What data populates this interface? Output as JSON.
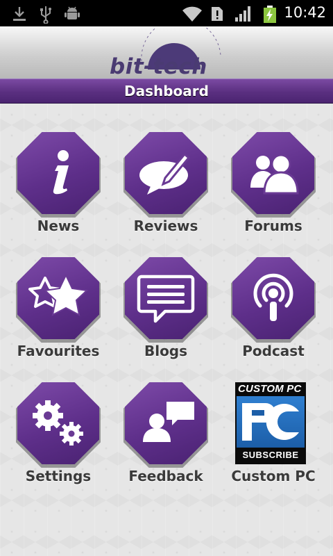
{
  "status_bar": {
    "time": "10:42",
    "icons": [
      "download-icon",
      "usb-icon",
      "android-debug-icon",
      "wifi-icon",
      "sim-alert-icon",
      "signal-icon",
      "battery-charging-icon"
    ]
  },
  "header": {
    "logo_text": "bit-tech",
    "logo_binary": "0101010101010101010"
  },
  "titlebar": {
    "title": "Dashboard"
  },
  "tiles": [
    {
      "label": "News",
      "icon": "info-icon"
    },
    {
      "label": "Reviews",
      "icon": "speech-bubble-pen-icon"
    },
    {
      "label": "Forums",
      "icon": "users-icon"
    },
    {
      "label": "Favourites",
      "icon": "stars-icon"
    },
    {
      "label": "Blogs",
      "icon": "message-lines-icon"
    },
    {
      "label": "Podcast",
      "icon": "podcast-icon"
    },
    {
      "label": "Settings",
      "icon": "gears-icon"
    },
    {
      "label": "Feedback",
      "icon": "person-speech-icon"
    },
    {
      "label": "Custom PC",
      "icon": "custom-pc-logo"
    }
  ],
  "custom_pc": {
    "top_text": "CUSTOM PC",
    "mid_text": "PC",
    "bottom_text": "SUBSCRIBE"
  },
  "colors": {
    "accent": "#5e2f8a",
    "titlebar": "#5a2f80",
    "background": "#e6e6e6"
  }
}
